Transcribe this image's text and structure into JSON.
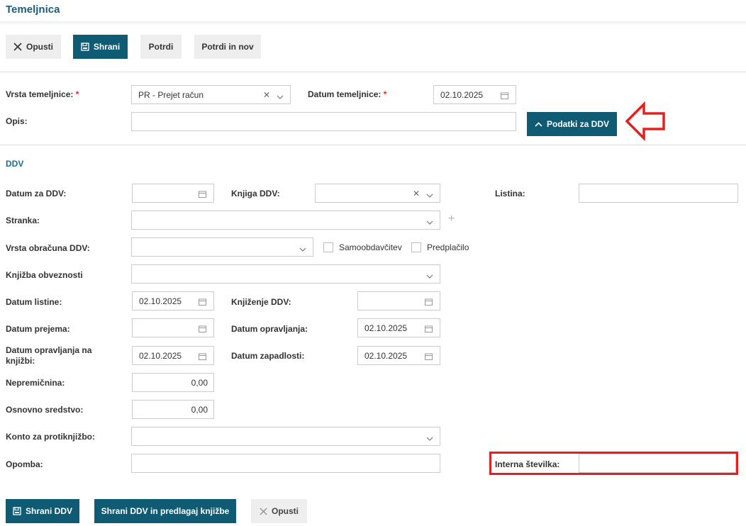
{
  "header": {
    "title": "Temeljnica"
  },
  "toolbar": {
    "cancel_label": "Opusti",
    "save_label": "Shrani",
    "confirm_label": "Potrdi",
    "confirm_new_label": "Potrdi in nov"
  },
  "form": {
    "type_label": "Vrsta temeljnice:",
    "type_value": "PR - Prejet račun",
    "date_label": "Datum temeljnice:",
    "date_value": "02.10.2025",
    "desc_label": "Opis:",
    "desc_value": "",
    "vat_toggle_label": "Podatki za DDV",
    "required_mark": "*"
  },
  "vat": {
    "section_title": "DDV",
    "date_for_vat_label": "Datum za DDV:",
    "vat_book_label": "Knjiga DDV:",
    "document_label": "Listina:",
    "party_label": "Stranka:",
    "calc_type_label": "Vrsta obračuna DDV:",
    "self_assessment_label": "Samoobdavčitev",
    "prepaid_label": "Predplačilo",
    "liability_booking_label": "Knjižba obveznosti",
    "doc_date_label": "Datum listine:",
    "doc_date_value": "02.10.2025",
    "vat_posting_label": "Knjiženje DDV:",
    "receipt_date_label": "Datum prejema:",
    "service_date_label": "Datum opravljanja:",
    "service_date_value": "02.10.2025",
    "service_date_booking_label": "Datum opravljanja na knjižbi:",
    "service_date_booking_value": "02.10.2025",
    "due_date_label": "Datum zapadlosti:",
    "due_date_value": "02.10.2025",
    "real_estate_label": "Nepremičnina:",
    "real_estate_value": "0,00",
    "fixed_asset_label": "Osnovno sredstvo:",
    "fixed_asset_value": "0,00",
    "contra_account_label": "Konto za protiknjižbo:",
    "note_label": "Opomba:",
    "internal_number_label": "Interna številka:"
  },
  "bottom_actions": {
    "save_vat_label": "Shrani DDV",
    "save_vat_propose_label": "Shrani DDV in predlagaj knjižbe",
    "cancel_label": "Opusti"
  },
  "colors": {
    "accent": "#0f5b74",
    "title": "#1b5e7b",
    "highlight": "#e32020"
  },
  "icons": {
    "close": "x-icon",
    "save": "floppy-icon",
    "calendar": "calendar-icon",
    "chevron": "chevron-down-icon",
    "chevron_up": "chevron-up-icon",
    "plus": "plus-icon",
    "arrow": "arrow-left-annotation-icon"
  }
}
